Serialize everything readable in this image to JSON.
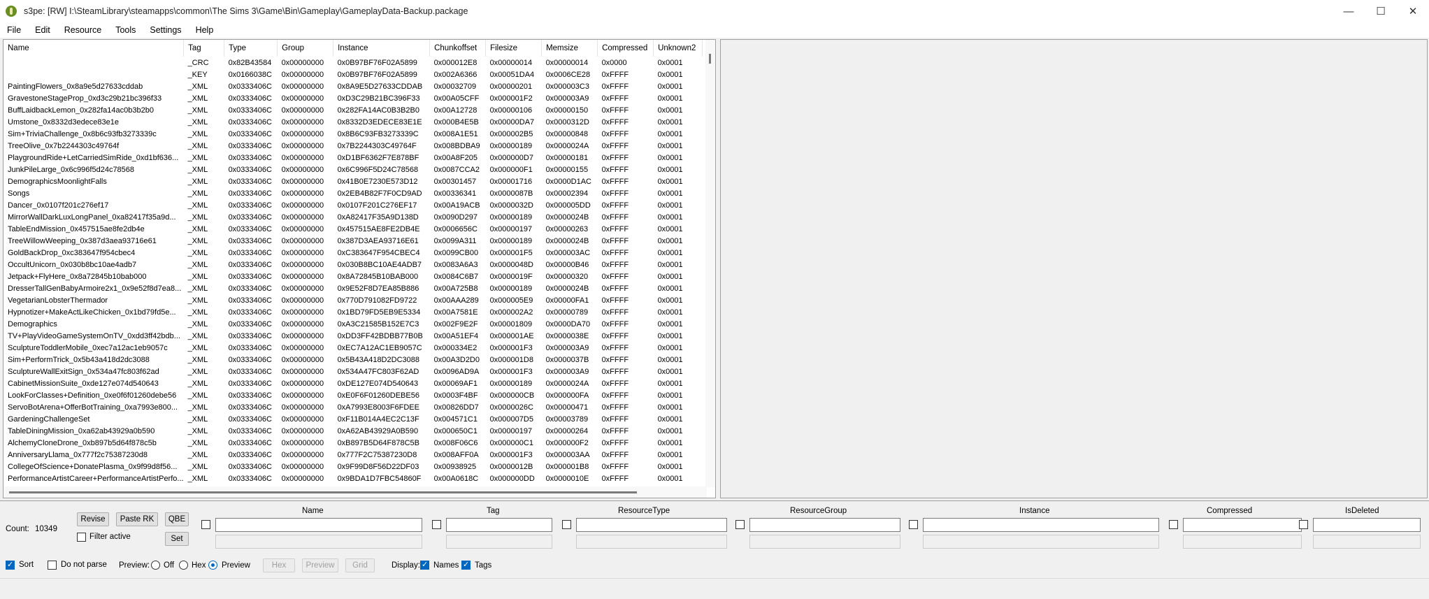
{
  "window": {
    "title": "s3pe: [RW] I:\\SteamLibrary\\steamapps\\common\\The Sims 3\\Game\\Bin\\Gameplay\\GameplayData-Backup.package"
  },
  "menu": [
    "File",
    "Edit",
    "Resource",
    "Tools",
    "Settings",
    "Help"
  ],
  "table": {
    "columns": [
      "Name",
      "Tag",
      "Type",
      "Group",
      "Instance",
      "Chunkoffset",
      "Filesize",
      "Memsize",
      "Compressed",
      "Unknown2"
    ],
    "rows": [
      [
        "",
        "_CRC",
        "0x82B43584",
        "0x00000000",
        "0x0B97BF76F02A5899",
        "0x000012E8",
        "0x00000014",
        "0x00000014",
        "0x0000",
        "0x0001"
      ],
      [
        "",
        "_KEY",
        "0x0166038C",
        "0x00000000",
        "0x0B97BF76F02A5899",
        "0x002A6366",
        "0x00051DA4",
        "0x0006CE28",
        "0xFFFF",
        "0x0001"
      ],
      [
        "PaintingFlowers_0x8a9e5d27633cddab",
        "_XML",
        "0x0333406C",
        "0x00000000",
        "0x8A9E5D27633CDDAB",
        "0x00032709",
        "0x00000201",
        "0x000003C3",
        "0xFFFF",
        "0x0001"
      ],
      [
        "GravestoneStageProp_0xd3c29b21bc396f33",
        "_XML",
        "0x0333406C",
        "0x00000000",
        "0xD3C29B21BC396F33",
        "0x00A05CFF",
        "0x000001F2",
        "0x000003A9",
        "0xFFFF",
        "0x0001"
      ],
      [
        "BuffLaidbackLemon_0x282fa14ac0b3b2b0",
        "_XML",
        "0x0333406C",
        "0x00000000",
        "0x282FA14AC0B3B2B0",
        "0x00A12728",
        "0x00000106",
        "0x00000150",
        "0xFFFF",
        "0x0001"
      ],
      [
        "Umstone_0x8332d3edece83e1e",
        "_XML",
        "0x0333406C",
        "0x00000000",
        "0x8332D3EDECE83E1E",
        "0x000B4E5B",
        "0x00000DA7",
        "0x0000312D",
        "0xFFFF",
        "0x0001"
      ],
      [
        "Sim+TriviaChallenge_0x8b6c93fb3273339c",
        "_XML",
        "0x0333406C",
        "0x00000000",
        "0x8B6C93FB3273339C",
        "0x008A1E51",
        "0x000002B5",
        "0x00000848",
        "0xFFFF",
        "0x0001"
      ],
      [
        "TreeOlive_0x7b2244303c49764f",
        "_XML",
        "0x0333406C",
        "0x00000000",
        "0x7B2244303C49764F",
        "0x008BDBA9",
        "0x00000189",
        "0x0000024A",
        "0xFFFF",
        "0x0001"
      ],
      [
        "PlaygroundRide+LetCarriedSimRide_0xd1bf636...",
        "_XML",
        "0x0333406C",
        "0x00000000",
        "0xD1BF6362F7E878BF",
        "0x00A8F205",
        "0x000000D7",
        "0x00000181",
        "0xFFFF",
        "0x0001"
      ],
      [
        "JunkPileLarge_0x6c996f5d24c78568",
        "_XML",
        "0x0333406C",
        "0x00000000",
        "0x6C996F5D24C78568",
        "0x0087CCA2",
        "0x000000F1",
        "0x00000155",
        "0xFFFF",
        "0x0001"
      ],
      [
        "DemographicsMoonlightFalls",
        "_XML",
        "0x0333406C",
        "0x00000000",
        "0x41B0E7230E573D12",
        "0x00301457",
        "0x00001716",
        "0x0000D1AC",
        "0xFFFF",
        "0x0001"
      ],
      [
        "Songs",
        "_XML",
        "0x0333406C",
        "0x00000000",
        "0x2EB4B82F7F0CD9AD",
        "0x00336341",
        "0x0000087B",
        "0x00002394",
        "0xFFFF",
        "0x0001"
      ],
      [
        "Dancer_0x0107f201c276ef17",
        "_XML",
        "0x0333406C",
        "0x00000000",
        "0x0107F201C276EF17",
        "0x00A19ACB",
        "0x0000032D",
        "0x000005DD",
        "0xFFFF",
        "0x0001"
      ],
      [
        "MirrorWallDarkLuxLongPanel_0xa82417f35a9d...",
        "_XML",
        "0x0333406C",
        "0x00000000",
        "0xA82417F35A9D138D",
        "0x0090D297",
        "0x00000189",
        "0x0000024B",
        "0xFFFF",
        "0x0001"
      ],
      [
        "TableEndMission_0x457515ae8fe2db4e",
        "_XML",
        "0x0333406C",
        "0x00000000",
        "0x457515AE8FE2DB4E",
        "0x0006656C",
        "0x00000197",
        "0x00000263",
        "0xFFFF",
        "0x0001"
      ],
      [
        "TreeWillowWeeping_0x387d3aea93716e61",
        "_XML",
        "0x0333406C",
        "0x00000000",
        "0x387D3AEA93716E61",
        "0x0099A311",
        "0x00000189",
        "0x0000024B",
        "0xFFFF",
        "0x0001"
      ],
      [
        "GoldBackDrop_0xc383647f954cbec4",
        "_XML",
        "0x0333406C",
        "0x00000000",
        "0xC383647F954CBEC4",
        "0x0099CB00",
        "0x000001F5",
        "0x000003AC",
        "0xFFFF",
        "0x0001"
      ],
      [
        "OccultUnicorn_0x030b8bc10ae4adb7",
        "_XML",
        "0x0333406C",
        "0x00000000",
        "0x030B8BC10AE4ADB7",
        "0x0083A6A3",
        "0x0000048D",
        "0x00000B46",
        "0xFFFF",
        "0x0001"
      ],
      [
        "Jetpack+FlyHere_0x8a72845b10bab000",
        "_XML",
        "0x0333406C",
        "0x00000000",
        "0x8A72845B10BAB000",
        "0x0084C6B7",
        "0x0000019F",
        "0x00000320",
        "0xFFFF",
        "0x0001"
      ],
      [
        "DresserTallGenBabyArmoire2x1_0x9e52f8d7ea8...",
        "_XML",
        "0x0333406C",
        "0x00000000",
        "0x9E52F8D7EA85B886",
        "0x00A725B8",
        "0x00000189",
        "0x0000024B",
        "0xFFFF",
        "0x0001"
      ],
      [
        "VegetarianLobsterThermador",
        "_XML",
        "0x0333406C",
        "0x00000000",
        "0x770D791082FD9722",
        "0x00AAA289",
        "0x000005E9",
        "0x00000FA1",
        "0xFFFF",
        "0x0001"
      ],
      [
        "Hypnotizer+MakeActLikeChicken_0x1bd79fd5e...",
        "_XML",
        "0x0333406C",
        "0x00000000",
        "0x1BD79FD5EB9E5334",
        "0x00A7581E",
        "0x000002A2",
        "0x00000789",
        "0xFFFF",
        "0x0001"
      ],
      [
        "Demographics",
        "_XML",
        "0x0333406C",
        "0x00000000",
        "0xA3C21585B152E7C3",
        "0x002F9E2F",
        "0x00001809",
        "0x0000DA70",
        "0xFFFF",
        "0x0001"
      ],
      [
        "TV+PlayVideoGameSystemOnTV_0xdd3ff42bdb...",
        "_XML",
        "0x0333406C",
        "0x00000000",
        "0xDD3FF42BDBB77B0B",
        "0x00A51EF4",
        "0x000001AE",
        "0x0000038E",
        "0xFFFF",
        "0x0001"
      ],
      [
        "SculptureToddlerMobile_0xec7a12ac1eb9057c",
        "_XML",
        "0x0333406C",
        "0x00000000",
        "0xEC7A12AC1EB9057C",
        "0x000334E2",
        "0x000001F3",
        "0x000003A9",
        "0xFFFF",
        "0x0001"
      ],
      [
        "Sim+PerformTrick_0x5b43a418d2dc3088",
        "_XML",
        "0x0333406C",
        "0x00000000",
        "0x5B43A418D2DC3088",
        "0x00A3D2D0",
        "0x000001D8",
        "0x0000037B",
        "0xFFFF",
        "0x0001"
      ],
      [
        "SculptureWallExitSign_0x534a47fc803f62ad",
        "_XML",
        "0x0333406C",
        "0x00000000",
        "0x534A47FC803F62AD",
        "0x0096AD9A",
        "0x000001F3",
        "0x000003A9",
        "0xFFFF",
        "0x0001"
      ],
      [
        "CabinetMissionSuite_0xde127e074d540643",
        "_XML",
        "0x0333406C",
        "0x00000000",
        "0xDE127E074D540643",
        "0x00069AF1",
        "0x00000189",
        "0x0000024A",
        "0xFFFF",
        "0x0001"
      ],
      [
        "LookForClasses+Definition_0xe0f6f01260debe56",
        "_XML",
        "0x0333406C",
        "0x00000000",
        "0xE0F6F01260DEBE56",
        "0x0003F4BF",
        "0x000000CB",
        "0x000000FA",
        "0xFFFF",
        "0x0001"
      ],
      [
        "ServoBotArena+OfferBotTraining_0xa7993e800...",
        "_XML",
        "0x0333406C",
        "0x00000000",
        "0xA7993E8003F6FDEE",
        "0x00826DD7",
        "0x0000026C",
        "0x00000471",
        "0xFFFF",
        "0x0001"
      ],
      [
        "GardeningChallengeSet",
        "_XML",
        "0x0333406C",
        "0x00000000",
        "0xF11B014A4EC2C13F",
        "0x004571C1",
        "0x000007D5",
        "0x00003789",
        "0xFFFF",
        "0x0001"
      ],
      [
        "TableDiningMission_0xa62ab43929a0b590",
        "_XML",
        "0x0333406C",
        "0x00000000",
        "0xA62AB43929A0B590",
        "0x000650C1",
        "0x00000197",
        "0x00000264",
        "0xFFFF",
        "0x0001"
      ],
      [
        "AlchemyCloneDrone_0xb897b5d64f878c5b",
        "_XML",
        "0x0333406C",
        "0x00000000",
        "0xB897B5D64F878C5B",
        "0x008F06C6",
        "0x000000C1",
        "0x000000F2",
        "0xFFFF",
        "0x0001"
      ],
      [
        "AnniversaryLlama_0x777f2c75387230d8",
        "_XML",
        "0x0333406C",
        "0x00000000",
        "0x777F2C75387230D8",
        "0x008AFF0A",
        "0x000001F3",
        "0x000003AA",
        "0xFFFF",
        "0x0001"
      ],
      [
        "CollegeOfScience+DonatePlasma_0x9f99d8f56...",
        "_XML",
        "0x0333406C",
        "0x00000000",
        "0x9F99D8F56D22DF03",
        "0x00938925",
        "0x0000012B",
        "0x000001B8",
        "0xFFFF",
        "0x0001"
      ],
      [
        "PerformanceArtistCareer+PerformanceArtistPerfo...",
        "_XML",
        "0x0333406C",
        "0x00000000",
        "0x9BDA1D7FBC54860F",
        "0x00A0618C",
        "0x000000DD",
        "0x0000010E",
        "0xFFFF",
        "0x0001"
      ]
    ]
  },
  "buttons": {
    "revise": "Revise",
    "paste_rk": "Paste RK",
    "qbe": "QBE",
    "set": "Set",
    "hex": "Hex",
    "preview": "Preview",
    "grid": "Grid"
  },
  "count": {
    "label": "Count:",
    "value": "10349"
  },
  "filter": {
    "active_label": "Filter active",
    "columns": [
      "Name",
      "Tag",
      "ResourceType",
      "ResourceGroup",
      "Instance",
      "Compressed",
      "IsDeleted"
    ]
  },
  "options": {
    "sort": "Sort",
    "do_not_parse": "Do not parse",
    "preview_label": "Preview:",
    "preview_off": "Off",
    "preview_hex": "Hex",
    "preview_preview": "Preview",
    "display_label": "Display:",
    "display_names": "Names",
    "display_tags": "Tags"
  }
}
